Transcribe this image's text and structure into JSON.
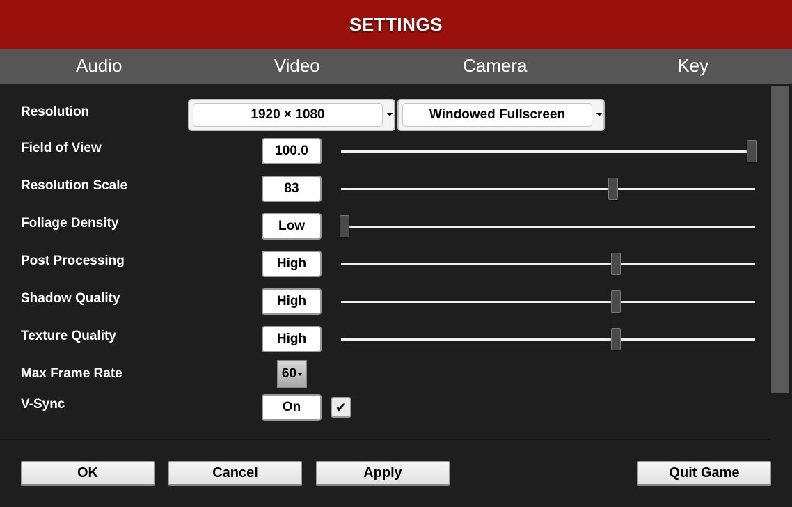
{
  "header": {
    "title": "SETTINGS"
  },
  "tabs": [
    {
      "label": "Audio"
    },
    {
      "label": "Video"
    },
    {
      "label": "Camera"
    },
    {
      "label": "Key"
    }
  ],
  "settings": {
    "resolution": {
      "label": "Resolution",
      "value": "1920 × 1080",
      "mode": "Windowed Fullscreen"
    },
    "field_of_view": {
      "label": "Field of View",
      "value": "100.0",
      "slider_fraction": 1.0
    },
    "resolution_scale": {
      "label": "Resolution Scale",
      "value": "83",
      "slider_fraction": 0.66
    },
    "foliage_density": {
      "label": "Foliage Density",
      "value": "Low",
      "slider_fraction": 0.0
    },
    "post_processing": {
      "label": "Post Processing",
      "value": "High",
      "slider_fraction": 0.667
    },
    "shadow_quality": {
      "label": "Shadow Quality",
      "value": "High",
      "slider_fraction": 0.667
    },
    "texture_quality": {
      "label": "Texture Quality",
      "value": "High",
      "slider_fraction": 0.667
    },
    "max_frame_rate": {
      "label": "Max Frame Rate",
      "value": "60"
    },
    "vsync": {
      "label": "V-Sync",
      "value": "On",
      "checked": true,
      "check_glyph": "✔"
    }
  },
  "buttons": {
    "ok": "OK",
    "cancel": "Cancel",
    "apply": "Apply",
    "quit": "Quit Game"
  },
  "colors": {
    "header": "#9a110c",
    "tabs": "#565656",
    "background": "#1e1e1e"
  }
}
